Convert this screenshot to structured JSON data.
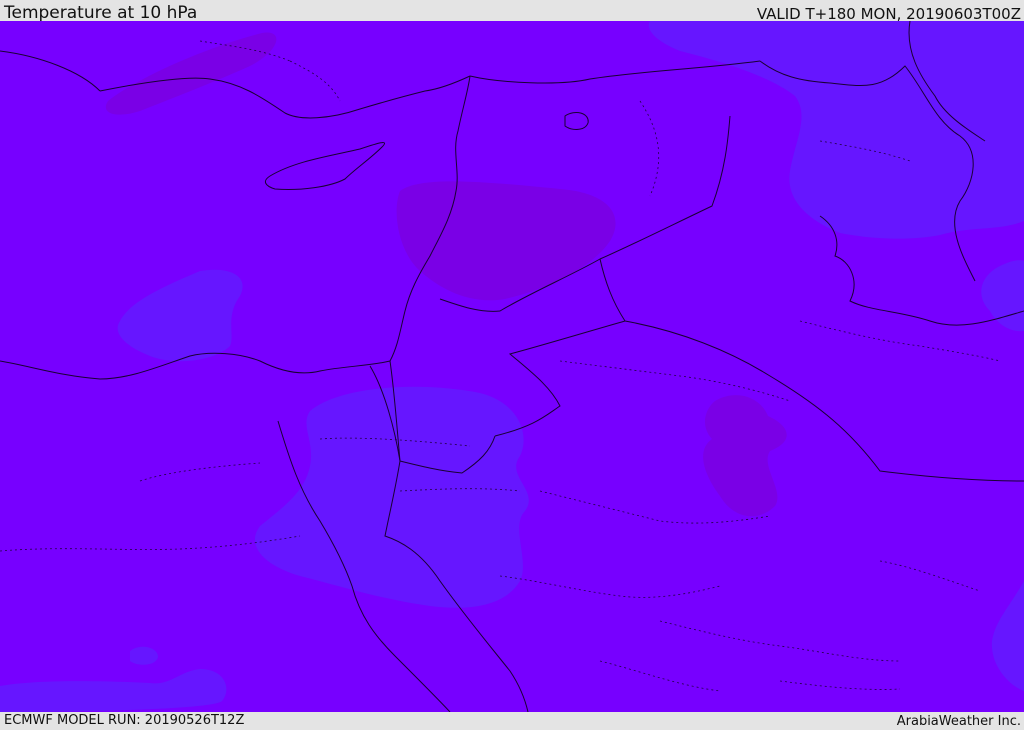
{
  "header": {
    "title": "Temperature at 10 hPa",
    "valid": "VALID T+180 MON, 20190603T00Z"
  },
  "footer": {
    "model_run": "ECMWF MODEL RUN: 20190526T12Z",
    "brand": "ArabiaWeather Inc."
  },
  "colors": {
    "base_field": "#7700ff",
    "warmer_field": "#7a00e6",
    "cooler_field": "#6616ff",
    "coastline": "#1a0033",
    "border": "#1a0033"
  },
  "map_layers": {
    "coastlines": "solid",
    "country_borders": "solid",
    "admin_borders": "dotted"
  }
}
